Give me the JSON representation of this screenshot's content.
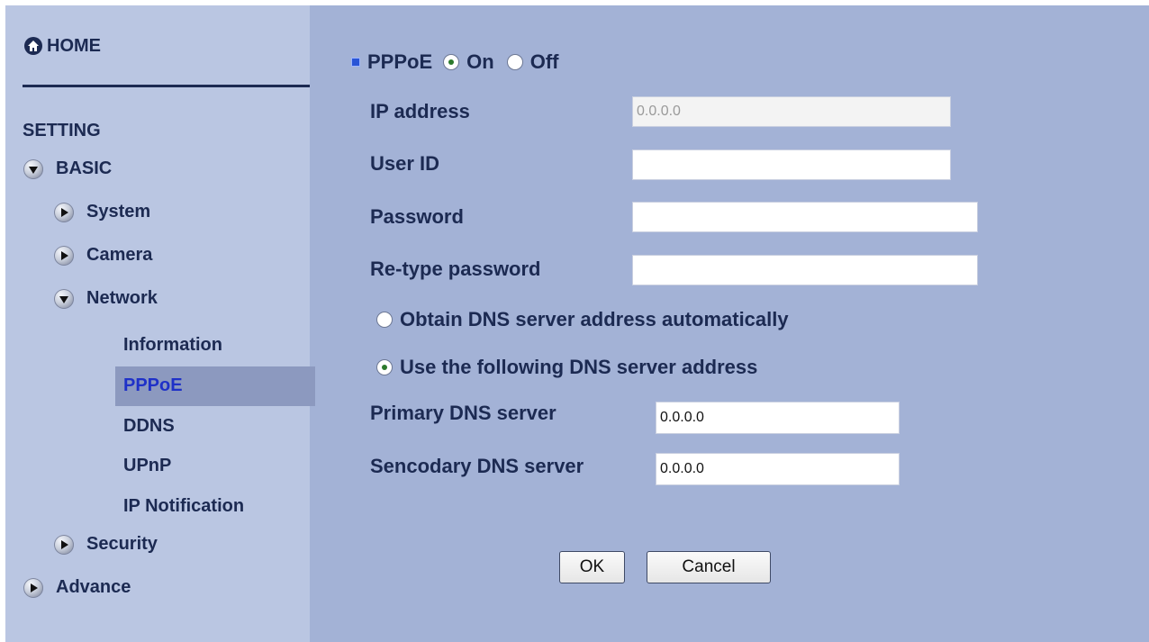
{
  "sidebar": {
    "home": "HOME",
    "setting": "SETTING",
    "basic": "BASIC",
    "system": "System",
    "camera": "Camera",
    "network": "Network",
    "network_items": [
      "Information",
      "PPPoE",
      "DDNS",
      "UPnP",
      "IP Notification"
    ],
    "active_item": "PPPoE",
    "security": "Security",
    "advance": "Advance"
  },
  "form": {
    "pppoe_label": "PPPoE",
    "on_label": "On",
    "off_label": "Off",
    "pppoe_state": "On",
    "ip_address_label": "IP address",
    "ip_address_value": "0.0.0.0",
    "user_id_label": "User ID",
    "user_id_value": "",
    "password_label": "Password",
    "password_value": "",
    "retype_label": "Re-type password",
    "retype_value": "",
    "dns_auto_label": "Obtain DNS server address automatically",
    "dns_manual_label": "Use the following DNS server address",
    "dns_mode": "manual",
    "primary_dns_label": "Primary DNS server",
    "primary_dns_value": "0.0.0.0",
    "secondary_dns_label": "Sencodary DNS server",
    "secondary_dns_value": "0.0.0.0"
  },
  "buttons": {
    "ok": "OK",
    "cancel": "Cancel"
  },
  "colors": {
    "main_bg": "#a3b2d6",
    "sidebar_bg": "#bac6e2",
    "active_bg": "#8c99bf",
    "active_text": "#1f31c8",
    "text": "#1c2a52"
  }
}
